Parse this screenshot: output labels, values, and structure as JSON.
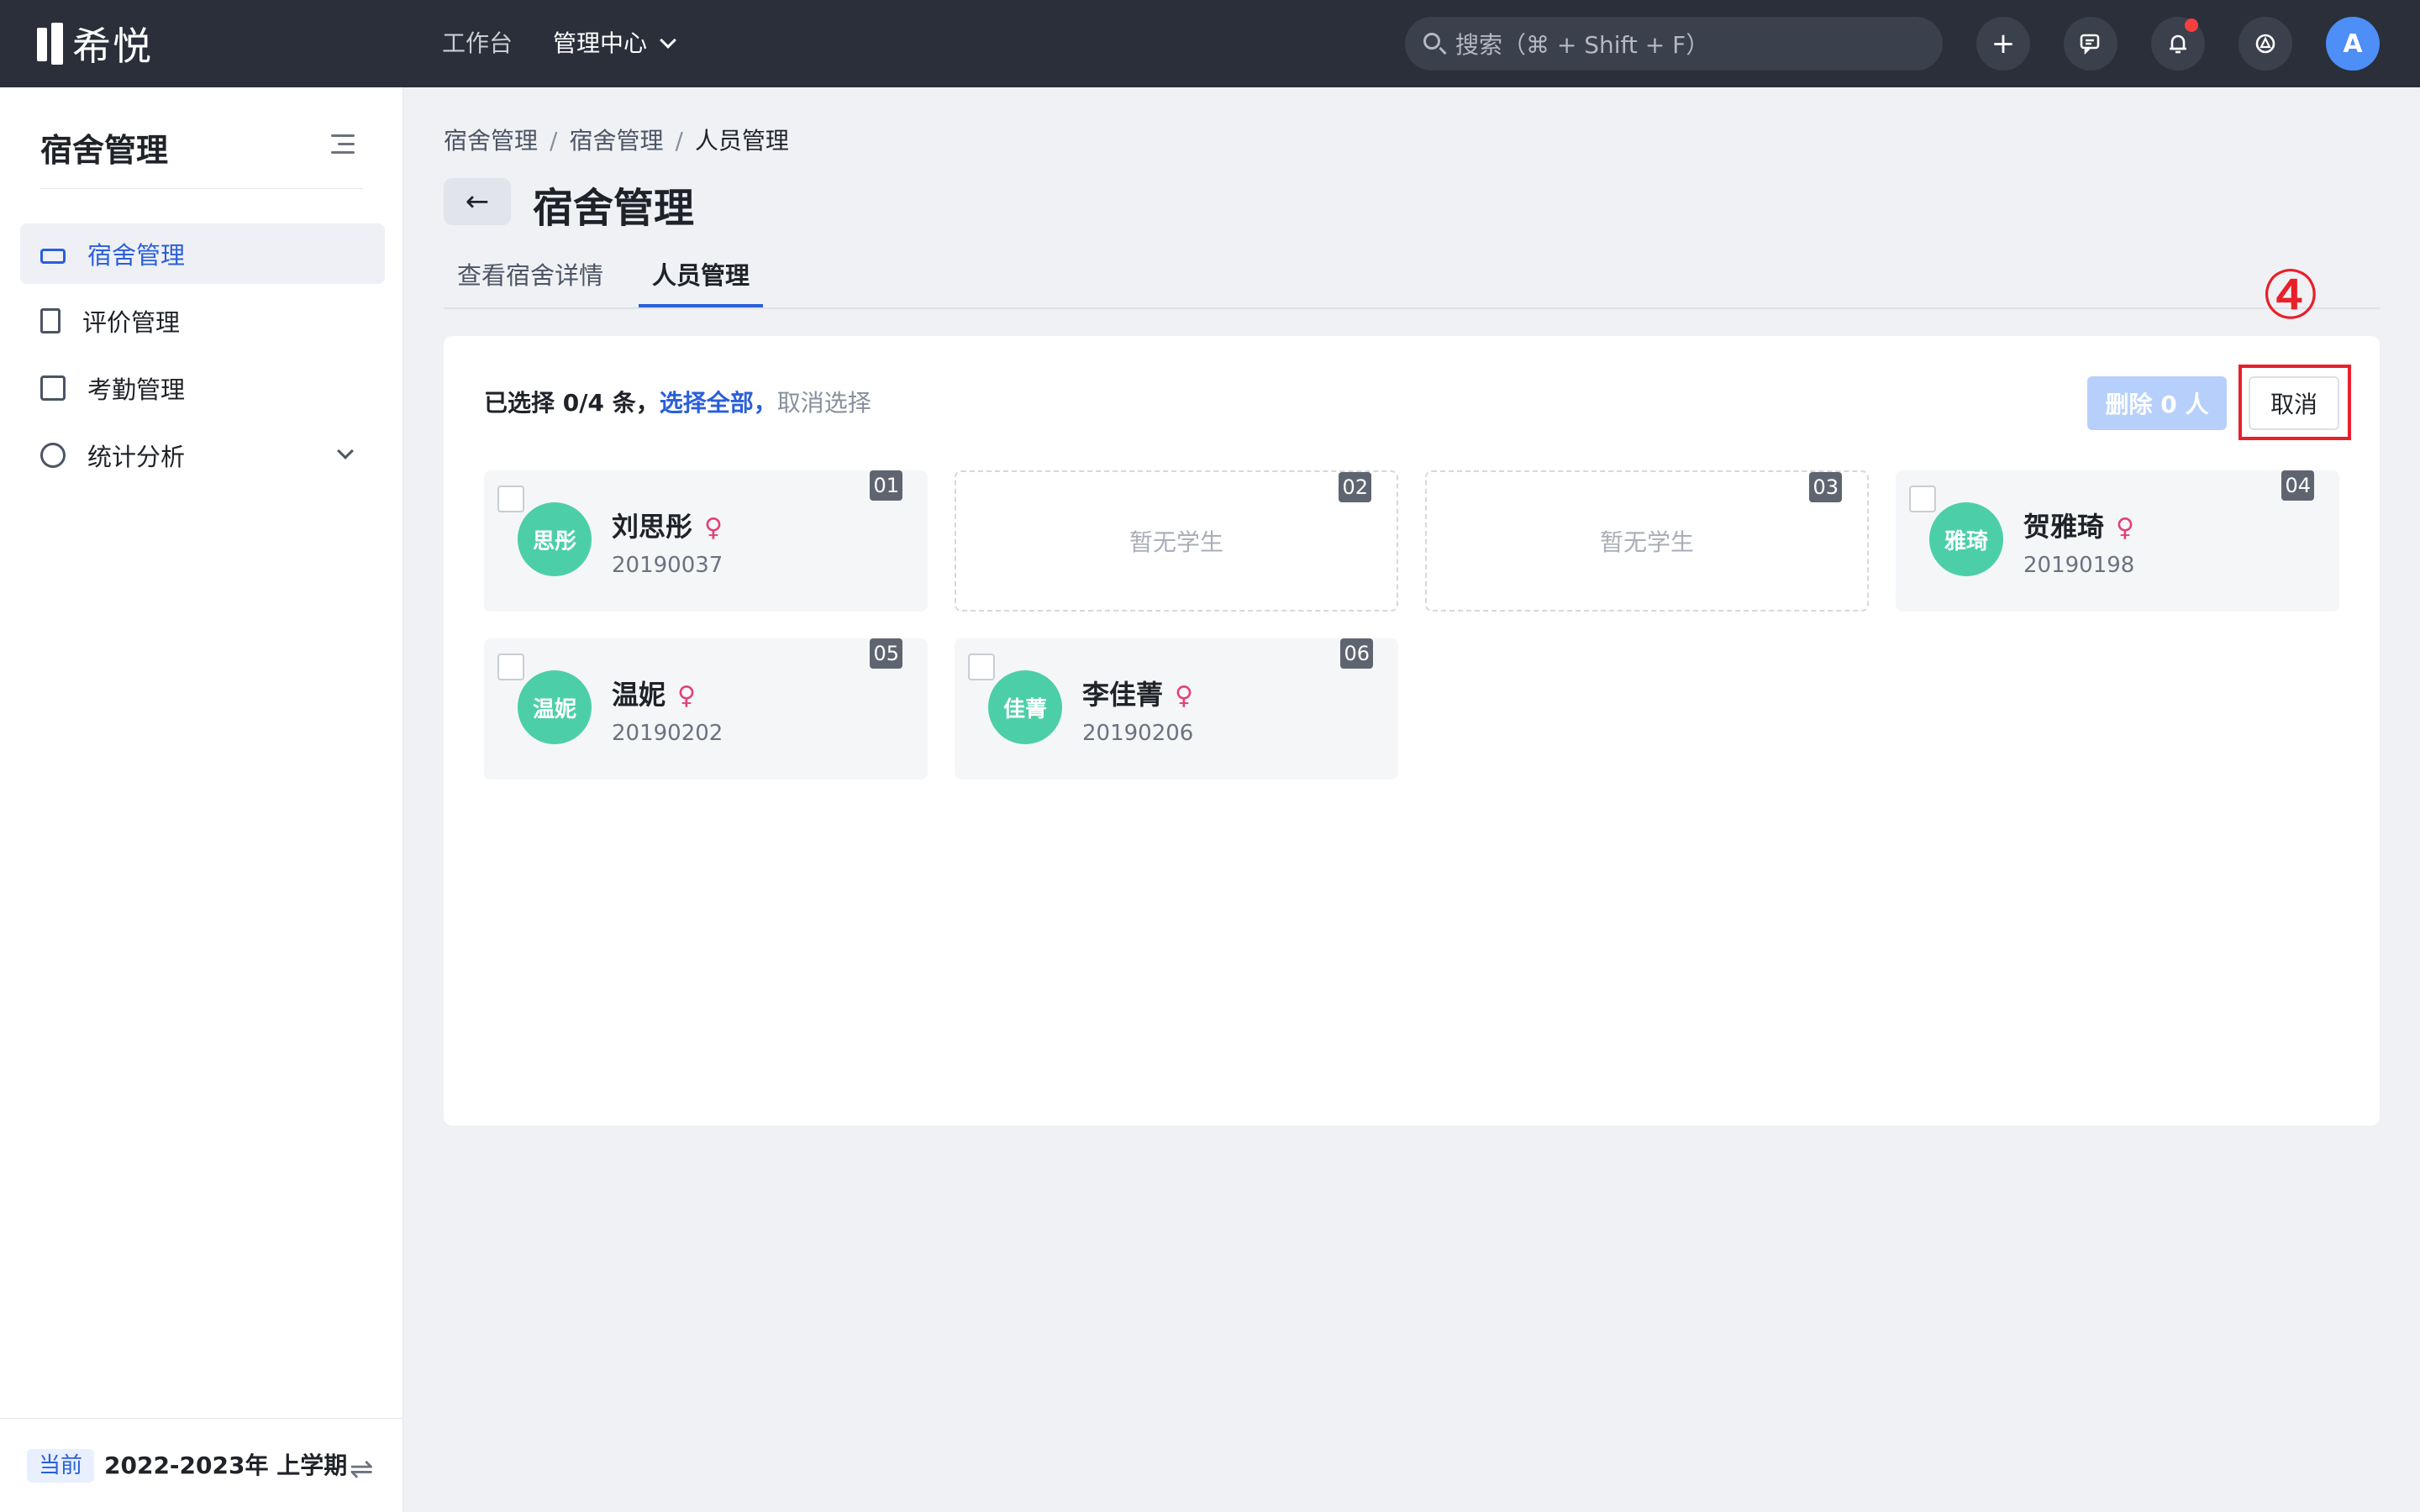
{
  "topbar": {
    "logo_text": "希悦",
    "nav": [
      {
        "label": "工作台"
      },
      {
        "label": "管理中心"
      }
    ],
    "search_placeholder": "搜索（⌘ + Shift + F）",
    "add_icon": "+",
    "avatar_letter": "A"
  },
  "sidebar": {
    "title": "宿舍管理",
    "items": [
      {
        "label": "宿舍管理",
        "icon": "bed-icon"
      },
      {
        "label": "评价管理",
        "icon": "document-icon"
      },
      {
        "label": "考勤管理",
        "icon": "calendar-icon"
      },
      {
        "label": "统计分析",
        "icon": "pie-chart-icon"
      }
    ],
    "footer": {
      "badge": "当前",
      "term": "2022-2023年 上学期",
      "swap_icon": "⇌"
    }
  },
  "main": {
    "breadcrumb": [
      "宿舍管理",
      "宿舍管理",
      "人员管理"
    ],
    "breadcrumb_sep": "/",
    "back_icon": "←",
    "title": "宿舍管理",
    "tabs": [
      {
        "label": "查看宿舍详情"
      },
      {
        "label": "人员管理"
      }
    ],
    "selection": {
      "prefix": "已选择 0/4 条，",
      "select_all": "选择全部，",
      "clear": "取消选择"
    },
    "delete_button": "删除 0 人",
    "cancel_button": "取消",
    "annotation": "④",
    "beds": [
      {
        "number": "01",
        "avatar": "思彤",
        "name": "刘思彤",
        "gender": "♀",
        "student_id": "20190037"
      },
      {
        "number": "02",
        "empty_text": "暂无学生"
      },
      {
        "number": "03",
        "empty_text": "暂无学生"
      },
      {
        "number": "04",
        "avatar": "雅琦",
        "name": "贺雅琦",
        "gender": "♀",
        "student_id": "20190198"
      },
      {
        "number": "05",
        "avatar": "温妮",
        "name": "温妮",
        "gender": "♀",
        "student_id": "20190202"
      },
      {
        "number": "06",
        "avatar": "佳菁",
        "name": "李佳菁",
        "gender": "♀",
        "student_id": "20190206"
      }
    ]
  },
  "colors": {
    "accent": "#2b5fd9",
    "avatar_bg": "#4ccfa8",
    "topbar_bg": "#2a2f3a",
    "annotation_red": "#e8202a"
  }
}
